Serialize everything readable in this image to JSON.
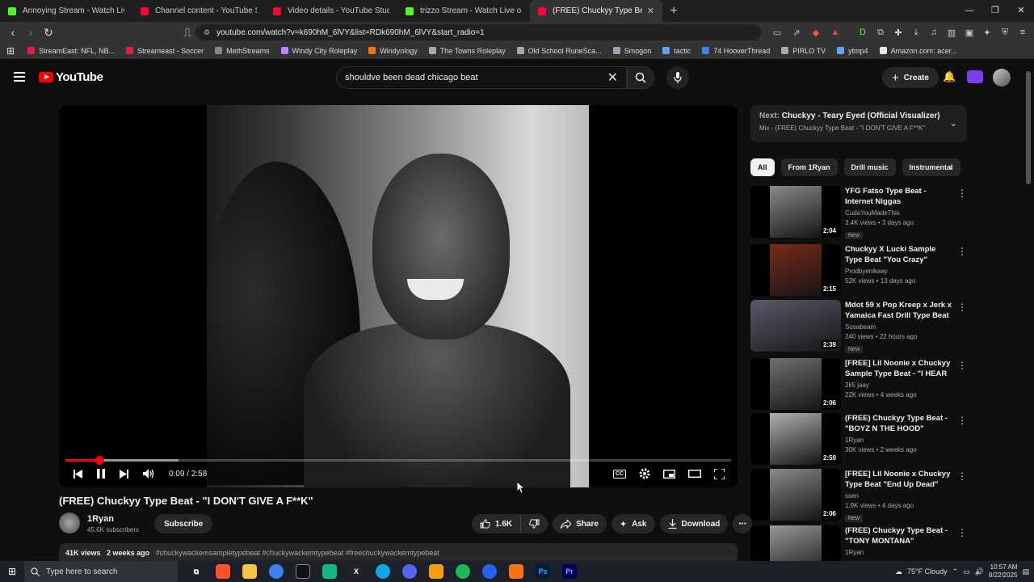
{
  "browser": {
    "tabs": [
      {
        "title": "Annoying Stream - Watch Live on Kick",
        "color": "#53fc18"
      },
      {
        "title": "Channel content - YouTube Studio",
        "color": "#ff0033"
      },
      {
        "title": "Video details - YouTube Studio",
        "color": "#ff0033"
      },
      {
        "title": "trizzo Stream - Watch Live on Kick",
        "color": "#53fc18"
      },
      {
        "title": "(FREE) Chuckyy Type Beat - \"I",
        "color": "#ff0033"
      }
    ],
    "url": "youtube.com/watch?v=k690hM_6lVY&list=RDk690hM_6lVY&start_radio=1",
    "bookmarks": [
      {
        "label": "StreamEast: NFL, NB...",
        "color": "#e11d48"
      },
      {
        "label": "Streameast - Soccer",
        "color": "#e11d48"
      },
      {
        "label": "MethStreams",
        "color": "#888888"
      },
      {
        "label": "Windy City Roleplay",
        "color": "#c084fc"
      },
      {
        "label": "Windyology",
        "color": "#f97316"
      },
      {
        "label": "The Towns Roleplay",
        "color": "#aaaaaa"
      },
      {
        "label": "Old School RuneSca...",
        "color": "#aaaaaa"
      },
      {
        "label": "Smogon",
        "color": "#9ca3af"
      },
      {
        "label": "tactic",
        "color": "#60a5fa"
      },
      {
        "label": "74 HooverThread",
        "color": "#3b82f6"
      },
      {
        "label": "PIRLO TV",
        "color": "#aaaaaa"
      },
      {
        "label": "ytmp4",
        "color": "#60a5fa"
      },
      {
        "label": "Amazon.com: acer...",
        "color": "#e5e7eb"
      }
    ]
  },
  "header": {
    "logo_text": "YouTube",
    "search_value": "shouldve been dead chicago beat",
    "create_label": "Create"
  },
  "player": {
    "progress_fraction": 0.051,
    "buffered_fraction": 0.17,
    "time": "0:09 / 2:58",
    "cc_label": "CC"
  },
  "video": {
    "title": "(FREE) Chuckyy Type Beat - \"I DON'T GIVE A F**K\"",
    "channel": "1Ryan",
    "subscribers": "45.6K subscribers",
    "subscribe_label": "Subscribe",
    "likes": "1.6K",
    "share_label": "Share",
    "ask_label": "Ask",
    "download_label": "Download",
    "views": "41K views",
    "age": "2 weeks ago",
    "tags": "#chuckywackemsampletypebeat #chuckywackemtypebeat #freechuckywackemtypebeat"
  },
  "sidebar": {
    "next_prefix": "Next:",
    "next_title": "Chuckyy - Teary Eyed (Official Visualizer)",
    "next_mix": "Mix - (FREE) Chuckyy Type Beat - \"I DON'T GIVE A F**K\"",
    "chips": [
      "All",
      "From 1Ryan",
      "Drill music",
      "Instrumental"
    ],
    "recommendations": [
      {
        "title": "YFG Fatso Type Beat - Internet Niggas",
        "channel": "CudaYouMadeThis",
        "stats": "3.4K views • 3 days ago",
        "badge": "New",
        "duration": "2:04",
        "tone": "#8a8a8a"
      },
      {
        "title": "Chuckyy X Lucki Sample Type Beat \"You Crazy\"",
        "channel": "Prodbyenikaay",
        "stats": "52K views • 13 days ago",
        "badge": "",
        "duration": "2:15",
        "tone": "#7a2a1a"
      },
      {
        "title": "Mdot 59 x Pop Kreep x Jerk x Yamaica Fast Drill Type Beat ...",
        "channel": "Sosabeam",
        "stats": "240 views • 22 hours ago",
        "badge": "New",
        "duration": "2:39",
        "tone": "#5a5a6a"
      },
      {
        "title": "[FREE] Lil Noonie x Chuckyy Sample Type Beat - \"I HEAR ...",
        "channel": "2k5 jaay",
        "stats": "22K views • 4 weeks ago",
        "badge": "",
        "duration": "2:06",
        "tone": "#707070"
      },
      {
        "title": "(FREE) Chuckyy Type Beat - \"BOYZ N THE HOOD\"",
        "channel": "1Ryan",
        "stats": "30K views • 2 weeks ago",
        "badge": "",
        "duration": "2:59",
        "tone": "#b0b0b0"
      },
      {
        "title": "[FREE] Lil Noonie x Chuckyy Type Beat \"End Up Dead\"",
        "channel": "ssen",
        "stats": "1.9K views • 4 days ago",
        "badge": "New",
        "duration": "2:06",
        "tone": "#8a8a8a"
      },
      {
        "title": "(FREE) Chuckyy Type Beat - \"TONY MONTANA\"",
        "channel": "1Ryan",
        "stats": "",
        "badge": "",
        "duration": "",
        "tone": "#999999"
      }
    ]
  },
  "taskbar": {
    "search_placeholder": "Type here to search",
    "weather": "75°F  Cloudy",
    "time": "10:57 AM",
    "date": "8/22/2025"
  }
}
